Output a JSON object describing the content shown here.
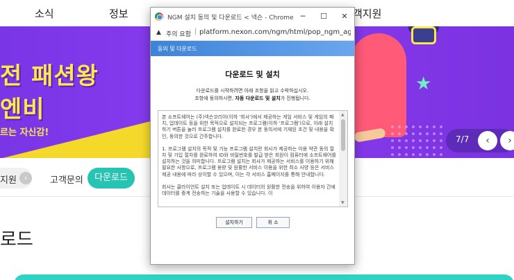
{
  "site": {
    "nav": {
      "item1": "소식",
      "item2": "정보",
      "item_right": "객지원"
    },
    "banner": {
      "title1": "전 패션왕",
      "title2": "엔비",
      "subtitle": "르는 자신감!"
    },
    "pager": {
      "current": "7",
      "total": "7",
      "prev": "‹",
      "next": "›"
    },
    "subnav": {
      "support": "지원",
      "arrow": "›",
      "inquiry": "고객문의",
      "download": "다운로드"
    },
    "section_title": "로드"
  },
  "popup": {
    "window_title": "NGM 설치 동의 및 다운로드 < 넥슨 - Chrome",
    "controls": {
      "minimize": "─",
      "maximize": "☐",
      "close": "✕"
    },
    "address": {
      "warning_icon": "▲",
      "not_secure": "주의 요함",
      "url": "platform.nexon.com/ngm/html/pop_ngm_agreem..."
    },
    "header_label": "동의 및 다운로드",
    "dialog_title": "다운로드 및 설치",
    "desc_line1": "다운로드를 시작하려면 아래 조항을 읽고 수락하십시오.",
    "desc_line2_pre": "조항에 동의하시면, ",
    "desc_line2_bold": "자동 다운로드 및 설치",
    "desc_line2_post": "가 진행됩니다.",
    "terms": {
      "p1": "본 소프트웨어는 (주)넥슨코리아(이하 '회사')에서 제공하는 게임 서비스 및 게임의 패치, 업데이트 등을 위한 목적으로 설치되는 프로그램(이하 '프로그램')으로, 아래 설치하기 버튼을 눌러 프로그램 설치를 완료한 경우 본 동의서에 기재된 조건 및 내용을 확인, 동의한 것으로 간주합니다.",
      "p2": "1. 프로그램 설치의 목적 및 기능 프로그램 설치란 회사가 제공하는 이용 약관 동의 절차 및 가입 절차를 완료하여 ID와 비밀번호를 발급 받은 회원이 컴퓨터에 소프트웨어를 설치하는 것을 의미합니다. 프로그램 설치는 회사가 제공하는 서비스를 이용하기 위해 필요한 사항으로, 프로그램 용량 및 원활한 서비스 이용을 위한 최소 사양 등은 서비스 제공 내용에 따라 상이할 수 있으며, 이는 각 서비스 홈페이지를 통해 안내합니다.",
      "p3": "회사는 클라이언트 설치 또는 업데이트 시 데이터의 원활한 전송을 위하여 이용자 간에 데이터를 중계 전송하는 기술을 사용할 수 있습니다. 이"
    },
    "buttons": {
      "install": "설치하기",
      "cancel": "취 소"
    }
  },
  "colors": {
    "banner_purple": "#7a35e6",
    "banner_yellow": "#ffe94a",
    "teal": "#27c4b4",
    "popup_header_blue": "#3e83d8"
  }
}
